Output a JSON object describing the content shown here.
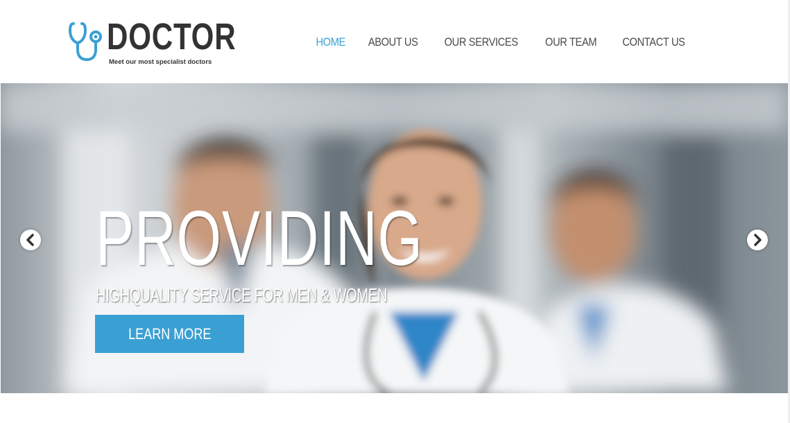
{
  "brand": {
    "title": "DOCTOR",
    "tagline": "Meet our most specialist doctors",
    "logo_icon": "stethoscope-icon",
    "text_color": "#333333",
    "icon_color": "#3aa0d4"
  },
  "nav": {
    "items": [
      {
        "label": "HOME",
        "active": true
      },
      {
        "label": "ABOUT US",
        "active": false
      },
      {
        "label": "OUR SERVICES",
        "active": false
      },
      {
        "label": "OUR TEAM",
        "active": false
      },
      {
        "label": "CONTACT US",
        "active": false
      }
    ],
    "active_color": "#3aa0d4",
    "text_color": "#4a4a4a"
  },
  "hero": {
    "heading": "PROVIDING",
    "subheading": "HIGHQUALITY SERVICE FOR MEN & WOMEN",
    "button_label": "LEARN MORE",
    "button_color": "#3aa0d4",
    "prev_icon": "chevron-left-icon",
    "next_icon": "chevron-right-icon"
  }
}
